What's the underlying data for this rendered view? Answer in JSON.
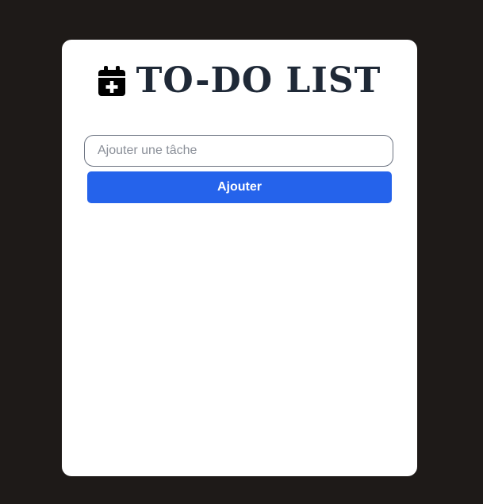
{
  "app": {
    "title": "TO-DO LIST",
    "title_icon": "calendar-plus-icon"
  },
  "form": {
    "input_placeholder": "Ajouter une tâche",
    "input_value": "",
    "add_button_label": "Ajouter"
  },
  "tasks": [],
  "colors": {
    "page_background": "#1e1a18",
    "card_background": "#ffffff",
    "title_text": "#1f2937",
    "button_background": "#2563eb",
    "button_text": "#ffffff",
    "input_border": "#6b7280"
  }
}
